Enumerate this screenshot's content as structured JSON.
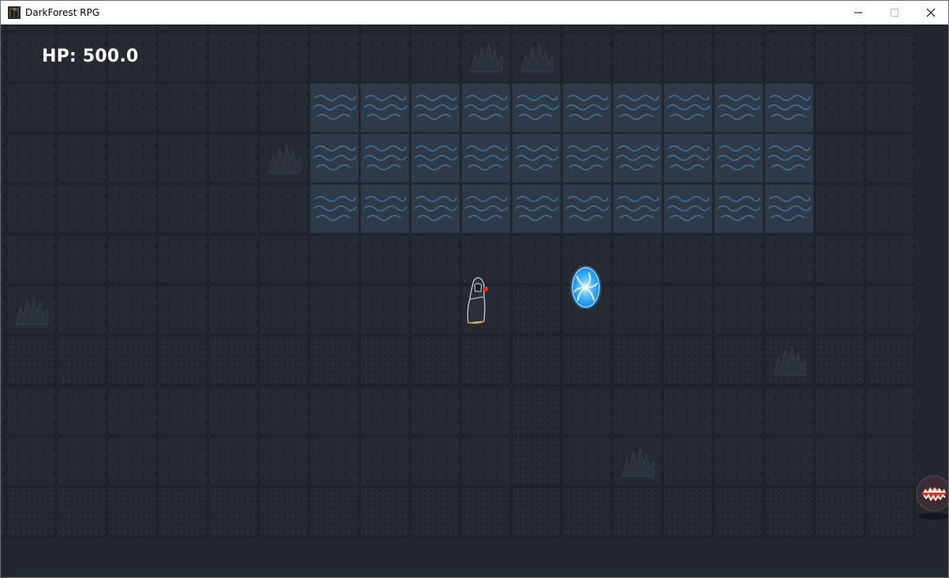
{
  "window": {
    "title": "DarkForest RPG",
    "controls": [
      "minimize-icon",
      "maximize-icon",
      "close-icon"
    ]
  },
  "hud": {
    "hp_text": "HP: 500.0"
  },
  "map": {
    "columns": 19,
    "rows": 11,
    "tile_legend": {
      "G": "grass",
      "D": "dirt",
      "W": "water"
    },
    "tiles": [
      "GGGGGGGGGGGGGGGGGGG",
      "GGGGGGGGGGGGGGGGGGG",
      "GGGGGGGWWWWWWWWWWGG",
      "GGGGGGGWWWWWWWWWWGG",
      "GGGGGGGWWWWWWWWWWGG",
      "GGGGGGGGGGGGGGGGGGG",
      "GGGGGGGGGGGDGGGGGGG",
      "DDDDDDDDDDDDDDDDDDD",
      "GGGGGGGGGGGDGGGGGGG",
      "GGGGGGGGGGGDGGGGGGG",
      "DDDDDDDDDDDDDDDDDDD"
    ],
    "bushes": [
      [
        1,
        10
      ],
      [
        1,
        11
      ],
      [
        3,
        6
      ],
      [
        6,
        1
      ],
      [
        7,
        16
      ],
      [
        9,
        13
      ]
    ],
    "entities": [
      {
        "name": "hooded-player",
        "col": 9,
        "row": 5
      },
      {
        "name": "blue-portal",
        "col": 11,
        "row": 5
      },
      {
        "name": "red-chomper-enemy",
        "col": 18,
        "row": 9
      }
    ]
  },
  "colors": {
    "background": "#232830",
    "water": "#2e3a48",
    "wave": "#3f6f96",
    "portal": "#38a7ef",
    "enemy_mouth": "#c0392b",
    "hp_text": "#ffffff"
  }
}
